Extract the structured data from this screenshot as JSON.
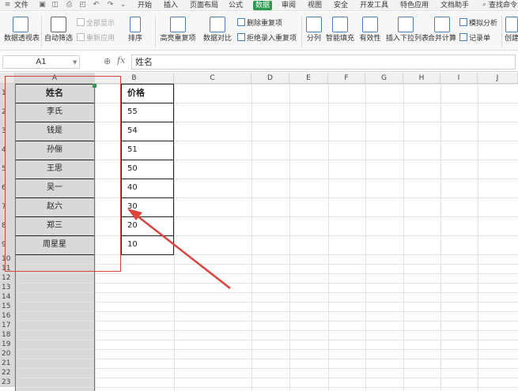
{
  "menubar": {
    "file": "文件",
    "tabs": [
      "开始",
      "插入",
      "页面布局",
      "公式",
      "数据",
      "审阅",
      "视图",
      "安全",
      "开发工具",
      "特色应用",
      "文档助手"
    ],
    "active_tab": "数据",
    "search": "查找命令"
  },
  "ribbon": {
    "pivot": "数据透视表",
    "autofilter": "自动筛选",
    "show_all": "全部显示",
    "reapply": "重新应用",
    "sort": "排序",
    "highlight_dup": "高亮重复项",
    "data_compare": "数据对比",
    "remove_dup": "删除重复项",
    "reject_dup": "拒绝录入重复项",
    "split": "分列",
    "smart_fill": "智能填充",
    "validity": "有效性",
    "dropdown": "插入下拉列表",
    "consolidate": "合并计算",
    "simulate": "模拟分析",
    "record": "记录单",
    "create": "创建"
  },
  "formula_bar": {
    "cell_ref": "A1",
    "fx": "fx",
    "content": "姓名"
  },
  "sheet": {
    "columns": [
      "A",
      "B",
      "C",
      "D",
      "E",
      "F",
      "G",
      "H",
      "I",
      "J"
    ],
    "selected_column": "A",
    "rows": [
      "1",
      "2",
      "3",
      "4",
      "5",
      "6",
      "7",
      "8",
      "9",
      "10",
      "11",
      "12",
      "13",
      "14",
      "15",
      "16",
      "17",
      "18",
      "19",
      "20",
      "21",
      "22",
      "23"
    ],
    "header_a": "姓名",
    "header_b": "价格",
    "names": [
      "李氏",
      "钱是",
      "孙俪",
      "王思",
      "吴一",
      "赵六",
      "郑三",
      "周星星"
    ],
    "prices": [
      "55",
      "54",
      "51",
      "50",
      "40",
      "30",
      "20",
      "10"
    ]
  },
  "colors": {
    "accent": "#2e9a4e",
    "annotation": "#e0423c",
    "selection": "#d9d9d9"
  }
}
